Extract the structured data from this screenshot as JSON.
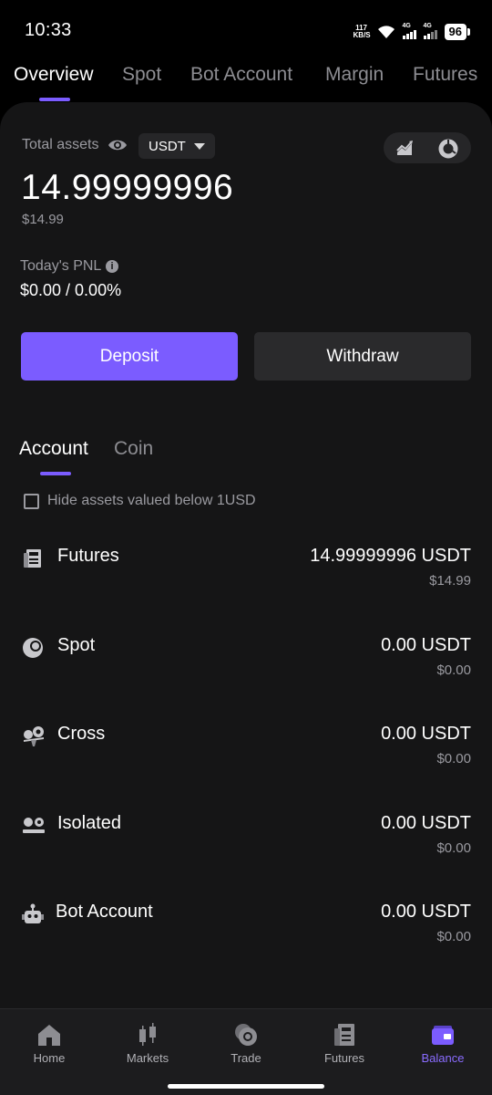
{
  "status_bar": {
    "time": "10:33",
    "net_speed_value": "117",
    "net_speed_unit": "KB/S",
    "signal1_label": "4G",
    "signal2_label": "4G",
    "battery": "96"
  },
  "top_tabs": [
    {
      "label": "Overview",
      "active": true
    },
    {
      "label": "Spot",
      "active": false
    },
    {
      "label": "Bot Account",
      "active": false
    },
    {
      "label": "Margin",
      "active": false
    },
    {
      "label": "Futures",
      "active": false
    }
  ],
  "summary": {
    "total_label": "Total assets",
    "currency": "USDT",
    "total_value": "14.99999996",
    "total_usd": "$14.99",
    "pnl_label": "Today's PNL",
    "pnl_info": "i",
    "pnl_value": "$0.00 / 0.00%"
  },
  "actions": {
    "deposit_label": "Deposit",
    "withdraw_label": "Withdraw"
  },
  "sub_tabs": [
    {
      "label": "Account",
      "active": true
    },
    {
      "label": "Coin",
      "active": false
    }
  ],
  "filter": {
    "hide_small_label": "Hide assets valued below 1USD",
    "checked": false
  },
  "accounts": [
    {
      "name": "Futures",
      "amount": "14.99999996 USDT",
      "usd": "$14.99",
      "icon": "futures-icon"
    },
    {
      "name": "Spot",
      "amount": "0.00 USDT",
      "usd": "$0.00",
      "icon": "spot-coin-icon"
    },
    {
      "name": "Cross",
      "amount": "0.00 USDT",
      "usd": "$0.00",
      "icon": "cross-margin-icon"
    },
    {
      "name": "Isolated",
      "amount": "0.00 USDT",
      "usd": "$0.00",
      "icon": "isolated-margin-icon"
    },
    {
      "name": "Bot Account",
      "amount": "0.00 USDT",
      "usd": "$0.00",
      "icon": "robot-icon"
    }
  ],
  "bottom_nav": [
    {
      "label": "Home",
      "icon": "home-icon",
      "active": false
    },
    {
      "label": "Markets",
      "icon": "candlestick-icon",
      "active": false
    },
    {
      "label": "Trade",
      "icon": "trade-icon",
      "active": false
    },
    {
      "label": "Futures",
      "icon": "futures-icon",
      "active": false
    },
    {
      "label": "Balance",
      "icon": "wallet-icon",
      "active": true
    }
  ],
  "colors": {
    "accent": "#7b5cff",
    "background": "#000000",
    "panel": "#151516",
    "muted_text": "#9a9aa0"
  }
}
